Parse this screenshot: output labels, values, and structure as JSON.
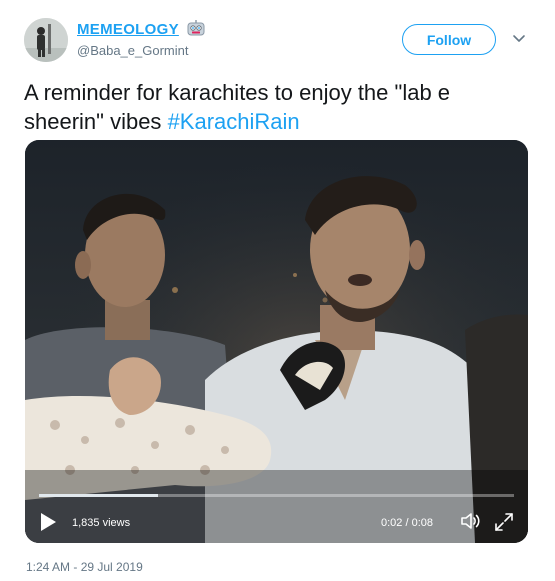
{
  "author": {
    "display_name": "MEMEOLOGY",
    "handle": "@Baba_e_Gormint"
  },
  "follow_button": {
    "label": "Follow"
  },
  "tweet": {
    "text": "A reminder for karachites to enjoy the \"lab e sheerin\" vibes ",
    "hashtag": "#KarachiRain"
  },
  "video": {
    "views": "1,835 views",
    "time": "0:02 / 0:08",
    "progress_fraction": 0.25
  },
  "timestamp": "1:24 AM - 29 Jul 2019",
  "icons": {
    "avatar": "avatar",
    "name_badge": "robot-face-icon",
    "more": "chevron-down-icon",
    "play": "play-icon",
    "volume": "volume-icon",
    "fullscreen": "fullscreen-icon"
  },
  "colors": {
    "accent": "#1da1f2",
    "text": "#14171a",
    "muted": "#657786"
  }
}
